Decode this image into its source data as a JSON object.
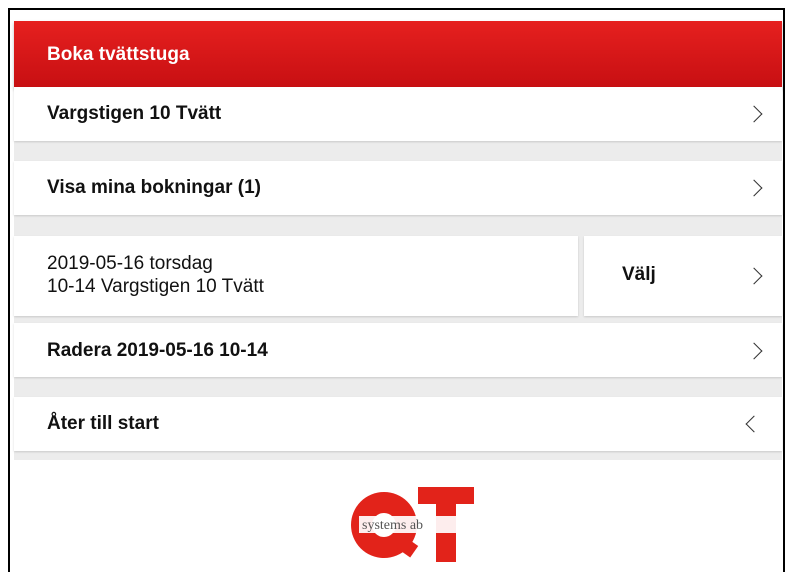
{
  "header": {
    "title": "Boka tvättstuga"
  },
  "menu": {
    "laundry_room": "Vargstigen 10 Tvätt",
    "my_bookings": "Visa mina bokningar (1)",
    "booking": {
      "date": "2019-05-16 torsdag",
      "slot": "10-14 Vargstigen 10 Tvätt",
      "select_label": "Välj"
    },
    "delete": "Radera 2019-05-16  10-14",
    "back": "Åter till start"
  },
  "logo": {
    "letters": "QT",
    "text": "systems ab",
    "color": "#e2231a"
  },
  "colors": {
    "header_bg": "#d7181a",
    "separator": "#ececec",
    "row_bg": "#ffffff"
  }
}
